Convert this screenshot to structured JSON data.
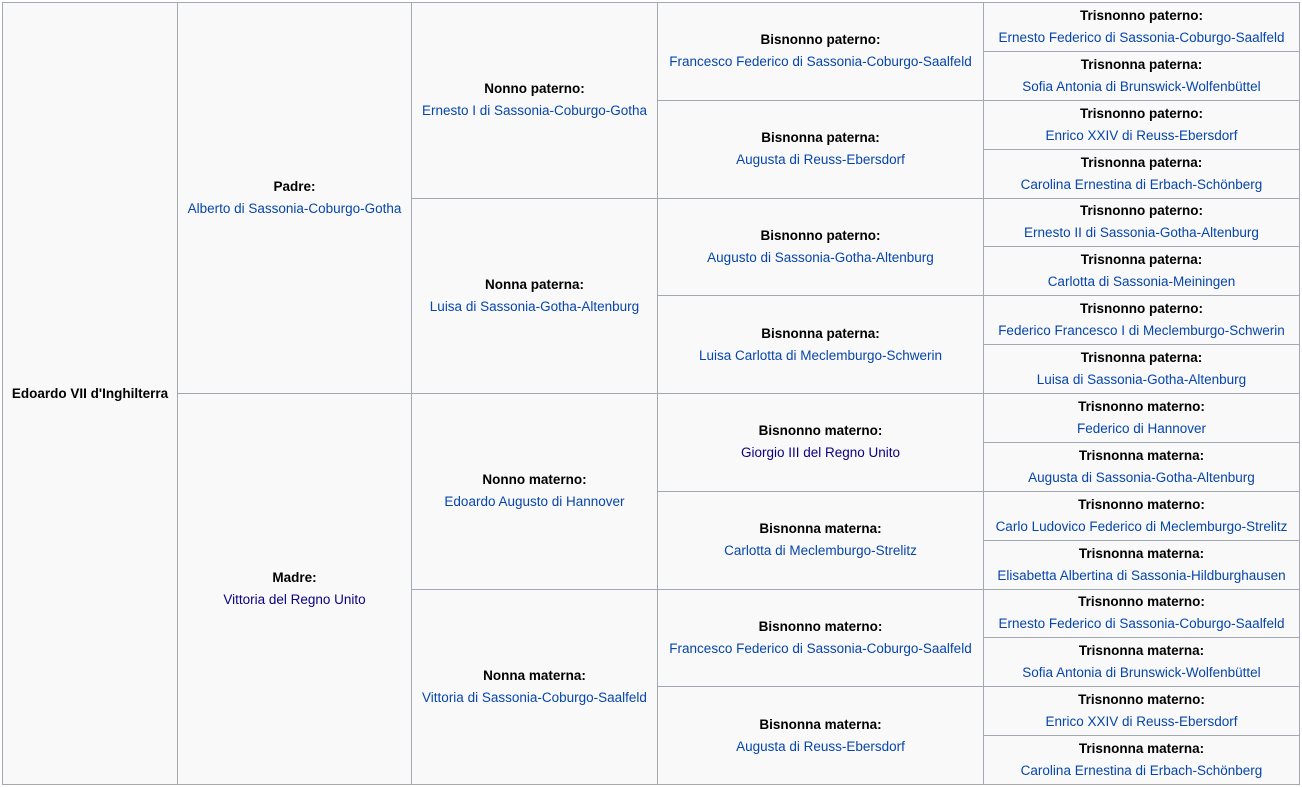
{
  "subject": "Edoardo VII d'Inghilterra",
  "parents": [
    {
      "role": "Padre:",
      "name": "Alberto di Sassonia-Coburgo-Gotha"
    },
    {
      "role": "Madre:",
      "name": "Vittoria del Regno Unito"
    }
  ],
  "grandparents": [
    {
      "role": "Nonno paterno:",
      "name": "Ernesto I di Sassonia-Coburgo-Gotha"
    },
    {
      "role": "Nonna paterna:",
      "name": "Luisa di Sassonia-Gotha-Altenburg"
    },
    {
      "role": "Nonno materno:",
      "name": "Edoardo Augusto di Hannover"
    },
    {
      "role": "Nonna materna:",
      "name": "Vittoria di Sassonia-Coburgo-Saalfeld"
    }
  ],
  "great_grandparents": [
    {
      "role": "Bisnonno paterno:",
      "name": "Francesco Federico di Sassonia-Coburgo-Saalfeld"
    },
    {
      "role": "Bisnonna paterna:",
      "name": "Augusta di Reuss-Ebersdorf"
    },
    {
      "role": "Bisnonno paterno:",
      "name": "Augusto di Sassonia-Gotha-Altenburg"
    },
    {
      "role": "Bisnonna paterna:",
      "name": "Luisa Carlotta di Meclemburgo-Schwerin"
    },
    {
      "role": "Bisnonno materno:",
      "name": "Giorgio III del Regno Unito"
    },
    {
      "role": "Bisnonna materna:",
      "name": "Carlotta di Meclemburgo-Strelitz"
    },
    {
      "role": "Bisnonno materno:",
      "name": "Francesco Federico di Sassonia-Coburgo-Saalfeld"
    },
    {
      "role": "Bisnonna materna:",
      "name": "Augusta di Reuss-Ebersdorf"
    }
  ],
  "great_great_grandparents": [
    {
      "role": "Trisnonno paterno:",
      "name": "Ernesto Federico di Sassonia-Coburgo-Saalfeld"
    },
    {
      "role": "Trisnonna paterna:",
      "name": "Sofia Antonia di Brunswick-Wolfenbüttel"
    },
    {
      "role": "Trisnonno paterno:",
      "name": "Enrico XXIV di Reuss-Ebersdorf"
    },
    {
      "role": "Trisnonna paterna:",
      "name": "Carolina Ernestina di Erbach-Schönberg"
    },
    {
      "role": "Trisnonno paterno:",
      "name": "Ernesto II di Sassonia-Gotha-Altenburg"
    },
    {
      "role": "Trisnonna paterna:",
      "name": "Carlotta di Sassonia-Meiningen"
    },
    {
      "role": "Trisnonno paterno:",
      "name": "Federico Francesco I di Meclemburgo-Schwerin"
    },
    {
      "role": "Trisnonna paterna:",
      "name": "Luisa di Sassonia-Gotha-Altenburg"
    },
    {
      "role": "Trisnonno materno:",
      "name": "Federico di Hannover"
    },
    {
      "role": "Trisnonna materna:",
      "name": "Augusta di Sassonia-Gotha-Altenburg"
    },
    {
      "role": "Trisnonno materno:",
      "name": "Carlo Ludovico Federico di Meclemburgo-Strelitz"
    },
    {
      "role": "Trisnonna materna:",
      "name": "Elisabetta Albertina di Sassonia-Hildburghausen"
    },
    {
      "role": "Trisnonno materno:",
      "name": "Ernesto Federico di Sassonia-Coburgo-Saalfeld"
    },
    {
      "role": "Trisnonna materna:",
      "name": "Sofia Antonia di Brunswick-Wolfenbüttel"
    },
    {
      "role": "Trisnonno materno:",
      "name": "Enrico XXIV di Reuss-Ebersdorf"
    },
    {
      "role": "Trisnonna materna:",
      "name": "Carolina Ernestina di Erbach-Schönberg"
    }
  ]
}
